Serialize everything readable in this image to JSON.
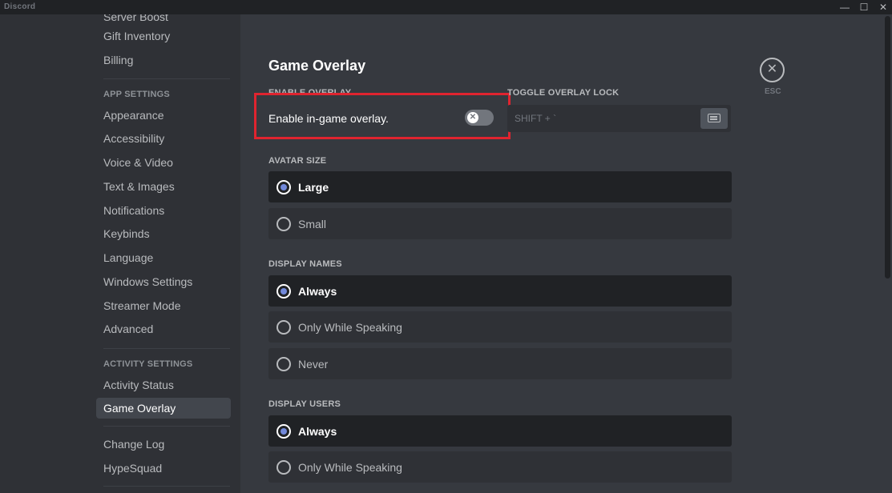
{
  "window": {
    "title": "Discord"
  },
  "sidebar": {
    "partial_top_item": "Server Boost",
    "user_items": [
      "Gift Inventory",
      "Billing"
    ],
    "app_settings_header": "APP SETTINGS",
    "app_items": [
      "Appearance",
      "Accessibility",
      "Voice & Video",
      "Text & Images",
      "Notifications",
      "Keybinds",
      "Language",
      "Windows Settings",
      "Streamer Mode",
      "Advanced"
    ],
    "activity_settings_header": "ACTIVITY SETTINGS",
    "activity_items": [
      "Activity Status",
      "Game Overlay"
    ],
    "selected": "Game Overlay",
    "misc_items": [
      "Change Log",
      "HypeSquad"
    ]
  },
  "main": {
    "title": "Game Overlay",
    "enable_overlay": {
      "header": "ENABLE OVERLAY",
      "label": "Enable in-game overlay.",
      "enabled": false
    },
    "toggle_lock": {
      "header": "TOGGLE OVERLAY LOCK",
      "keybind": "SHIFT + `"
    },
    "avatar_size": {
      "header": "AVATAR SIZE",
      "options": [
        "Large",
        "Small"
      ],
      "selected": "Large"
    },
    "display_names": {
      "header": "DISPLAY NAMES",
      "options": [
        "Always",
        "Only While Speaking",
        "Never"
      ],
      "selected": "Always"
    },
    "display_users": {
      "header": "DISPLAY USERS",
      "options": [
        "Always",
        "Only While Speaking"
      ],
      "selected": "Always"
    },
    "close": {
      "label": "ESC"
    }
  },
  "colors": {
    "background": "#36393f",
    "sidebar": "#2f3136",
    "accent": "#7289da",
    "highlight": "#e0242f"
  }
}
